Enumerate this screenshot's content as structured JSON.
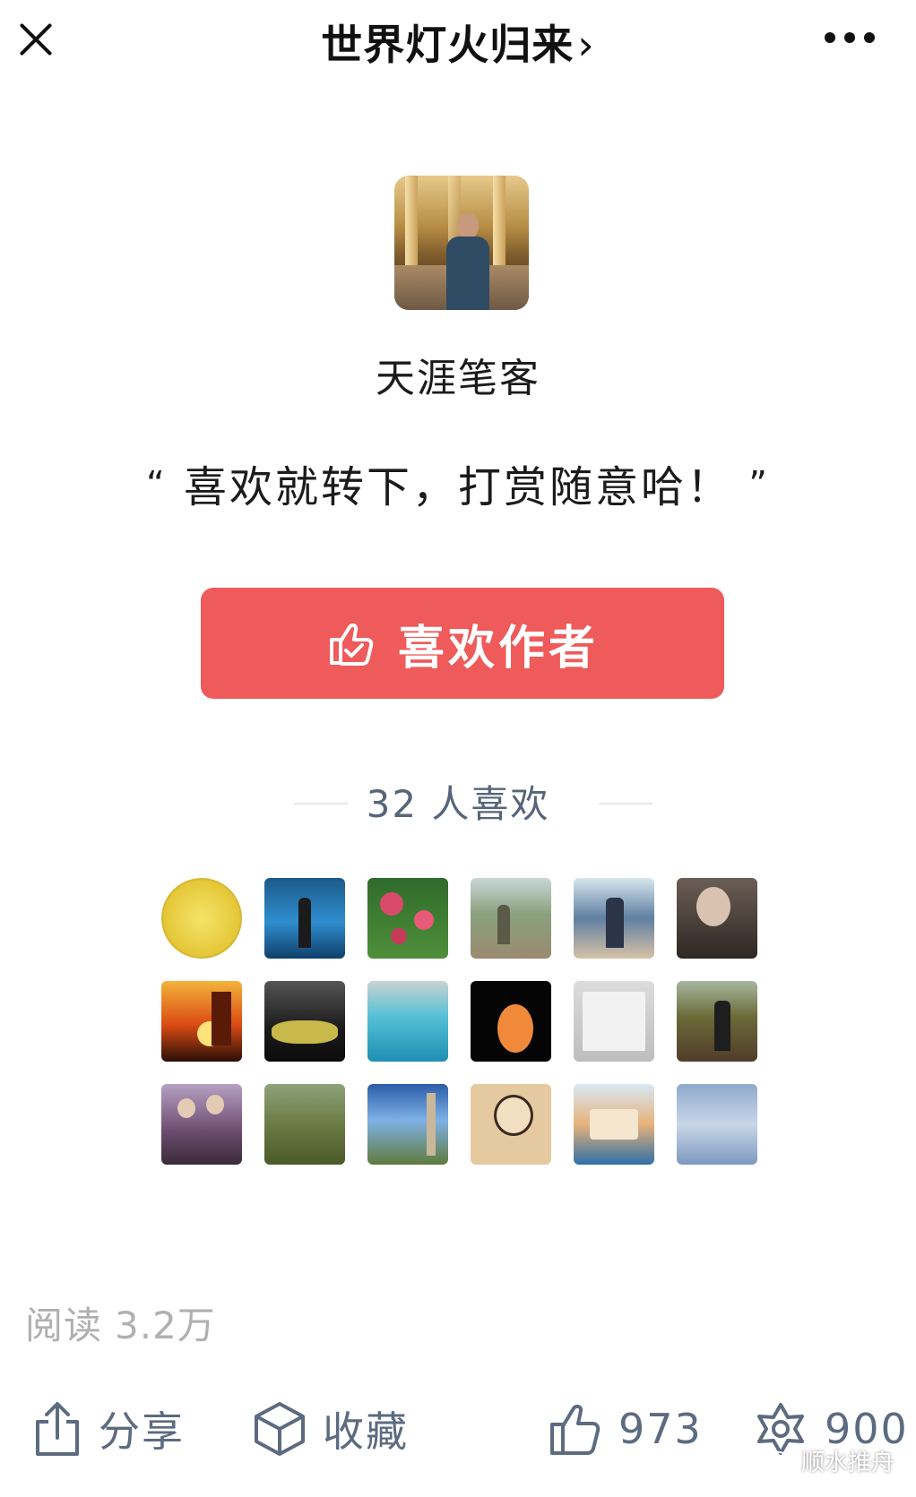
{
  "header": {
    "title": "世界灯火归来",
    "title_chevron": "›"
  },
  "author": {
    "name": "天涯笔客",
    "quote_open": "“",
    "quote_text": "喜欢就转下，打赏随意哈！",
    "quote_close": "”",
    "like_button_label": "喜欢作者"
  },
  "likes": {
    "count_label": "32 人喜欢",
    "avatars": [
      "coin",
      "aquarium",
      "flowers",
      "park-statues",
      "man-at-bridge",
      "violinist",
      "sunset-junk",
      "sports-car",
      "pool",
      "orange-figurine",
      "notebook",
      "man-in-garden",
      "elderly-couple",
      "lily-pond",
      "campus-tower",
      "ink-portrait",
      "sailing-ship",
      "blue-sky"
    ]
  },
  "footer": {
    "read_label": "阅读",
    "read_value": "3.2万",
    "share_label": "分享",
    "favorite_label": "收藏",
    "like_count": "973",
    "wow_count": "900",
    "watermark": "顺水推舟"
  },
  "colors": {
    "accent_red": "#ef5a5a",
    "muted_blue": "#5c6b80",
    "muted_gray": "#b0b0b0"
  }
}
